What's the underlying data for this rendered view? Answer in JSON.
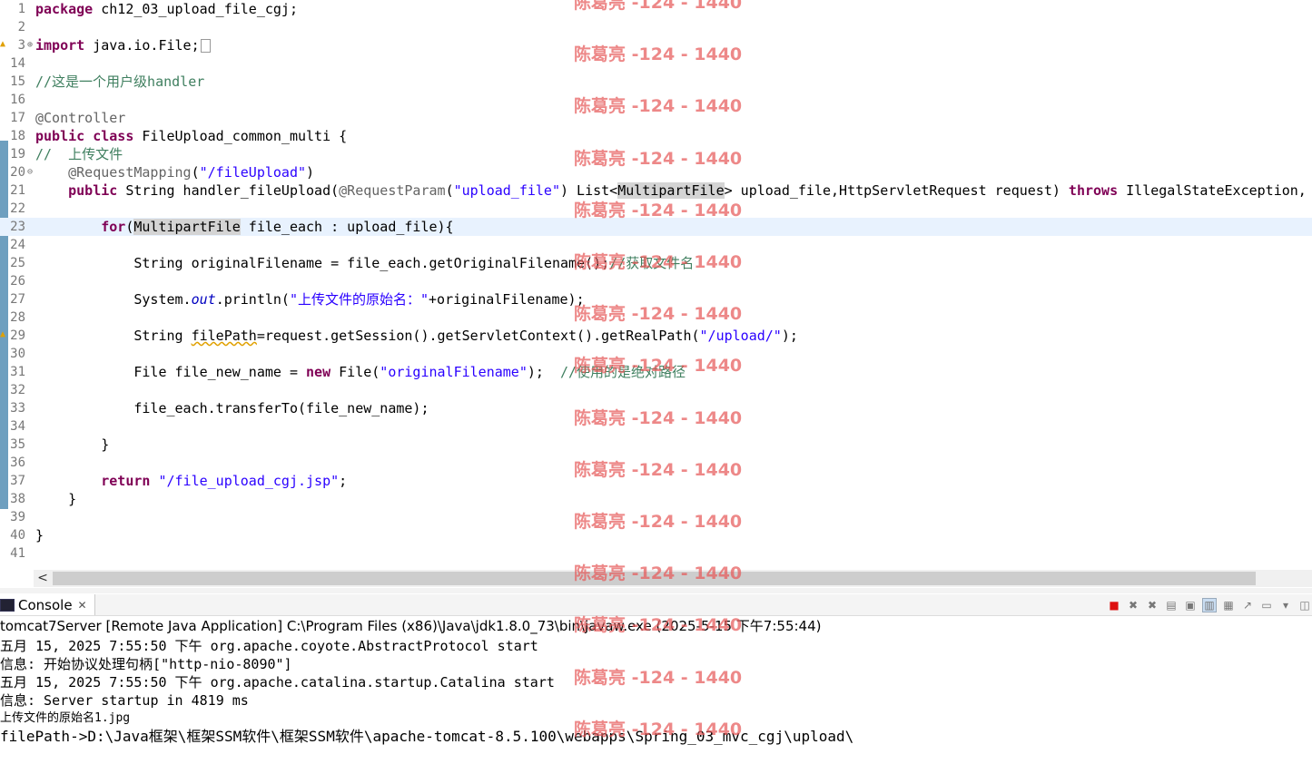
{
  "editor": {
    "lines": [
      {
        "n": "1",
        "segs": [
          {
            "t": "package",
            "c": "kw"
          },
          {
            "t": " ch12_03_upload_file_cgj;"
          }
        ]
      },
      {
        "n": "2",
        "segs": []
      },
      {
        "n": "3",
        "fold": "⊕",
        "warn": true,
        "box": true,
        "segs": [
          {
            "t": "import",
            "c": "kw"
          },
          {
            "t": " java.io.File;"
          }
        ]
      },
      {
        "n": "14",
        "segs": []
      },
      {
        "n": "15",
        "segs": [
          {
            "t": "//这是一个用户级handler",
            "c": "cmt"
          }
        ]
      },
      {
        "n": "16",
        "segs": []
      },
      {
        "n": "17",
        "segs": [
          {
            "t": "@Controller",
            "c": "ann"
          }
        ]
      },
      {
        "n": "18",
        "segs": [
          {
            "t": "public",
            "c": "kw"
          },
          {
            "t": " "
          },
          {
            "t": "class",
            "c": "kw"
          },
          {
            "t": " FileUpload_common_multi {"
          }
        ]
      },
      {
        "n": "19",
        "segs": [
          {
            "t": "//  上传文件",
            "c": "cmt"
          }
        ]
      },
      {
        "n": "20",
        "fold": "⊖",
        "segs": [
          {
            "t": "    "
          },
          {
            "t": "@RequestMapping",
            "c": "ann"
          },
          {
            "t": "("
          },
          {
            "t": "\"/fileUpload\"",
            "c": "str"
          },
          {
            "t": ")"
          }
        ]
      },
      {
        "n": "21",
        "segs": [
          {
            "t": "    "
          },
          {
            "t": "public",
            "c": "kw"
          },
          {
            "t": " String handler_fileUpload("
          },
          {
            "t": "@RequestParam",
            "c": "ann"
          },
          {
            "t": "("
          },
          {
            "t": "\"upload_file\"",
            "c": "str"
          },
          {
            "t": ") List<"
          },
          {
            "t": "MultipartFile",
            "c": "hl"
          },
          {
            "t": "> upload_file,HttpServletRequest request) "
          },
          {
            "t": "throws",
            "c": "kw"
          },
          {
            "t": " IllegalStateException, I"
          }
        ]
      },
      {
        "n": "22",
        "segs": []
      },
      {
        "n": "23",
        "current": true,
        "segs": [
          {
            "t": "        "
          },
          {
            "t": "for",
            "c": "kw"
          },
          {
            "t": "("
          },
          {
            "t": "MultipartFile",
            "c": "hl"
          },
          {
            "t": " file_each : upload_file){"
          }
        ]
      },
      {
        "n": "24",
        "segs": []
      },
      {
        "n": "25",
        "segs": [
          {
            "t": "            String originalFilename = file_each.getOriginalFilename();"
          },
          {
            "t": "//获取文件名",
            "c": "cmt"
          }
        ]
      },
      {
        "n": "26",
        "segs": []
      },
      {
        "n": "27",
        "segs": [
          {
            "t": "            System."
          },
          {
            "t": "out",
            "c": "ital"
          },
          {
            "t": ".println("
          },
          {
            "t": "\"上传文件的原始名：\"",
            "c": "str"
          },
          {
            "t": "+originalFilename);"
          }
        ]
      },
      {
        "n": "28",
        "segs": []
      },
      {
        "n": "29",
        "warn": true,
        "segs": [
          {
            "t": "            String "
          },
          {
            "t": "filePath",
            "c": "squig"
          },
          {
            "t": "=request.getSession().getServletContext().getRealPath("
          },
          {
            "t": "\"/upload/\"",
            "c": "str"
          },
          {
            "t": ");"
          }
        ]
      },
      {
        "n": "30",
        "segs": []
      },
      {
        "n": "31",
        "segs": [
          {
            "t": "            File file_new_name = "
          },
          {
            "t": "new",
            "c": "kw"
          },
          {
            "t": " File("
          },
          {
            "t": "\"originalFilename\"",
            "c": "str"
          },
          {
            "t": ");  "
          },
          {
            "t": "//使用的是绝对路径",
            "c": "cmt"
          }
        ]
      },
      {
        "n": "32",
        "segs": []
      },
      {
        "n": "33",
        "segs": [
          {
            "t": "            file_each.transferTo(file_new_name);"
          }
        ]
      },
      {
        "n": "34",
        "segs": []
      },
      {
        "n": "35",
        "segs": [
          {
            "t": "        }"
          }
        ]
      },
      {
        "n": "36",
        "segs": []
      },
      {
        "n": "37",
        "segs": [
          {
            "t": "        "
          },
          {
            "t": "return",
            "c": "kw"
          },
          {
            "t": " "
          },
          {
            "t": "\"/file_upload_cgj.jsp\"",
            "c": "str"
          },
          {
            "t": ";"
          }
        ]
      },
      {
        "n": "38",
        "segs": [
          {
            "t": "    }"
          }
        ]
      },
      {
        "n": "39",
        "segs": []
      },
      {
        "n": "40",
        "segs": [
          {
            "t": "}"
          }
        ]
      },
      {
        "n": "41",
        "segs": []
      }
    ]
  },
  "scrollbar": {
    "left_arrow": "<"
  },
  "console": {
    "tab_label": "Console",
    "tab_close": "✕",
    "toolbar": [
      {
        "name": "terminate-icon",
        "glyph": "■",
        "cls": "stop"
      },
      {
        "name": "remove-launch-icon",
        "glyph": "✖",
        "cls": ""
      },
      {
        "name": "remove-all-icon",
        "glyph": "✖",
        "cls": ""
      },
      {
        "name": "clear-console-icon",
        "glyph": "▤",
        "cls": ""
      },
      {
        "name": "scroll-lock-icon",
        "glyph": "▣",
        "cls": ""
      },
      {
        "name": "word-wrap-icon",
        "glyph": "▥",
        "cls": "active"
      },
      {
        "name": "show-on-output-icon",
        "glyph": "▦",
        "cls": ""
      },
      {
        "name": "pin-console-icon",
        "glyph": "↗",
        "cls": ""
      },
      {
        "name": "display-console-icon",
        "glyph": "▭",
        "cls": ""
      },
      {
        "name": "dropdown-icon",
        "glyph": "▾",
        "cls": ""
      },
      {
        "name": "new-console-icon",
        "glyph": "◫",
        "cls": ""
      }
    ],
    "process": "tomcat7Server [Remote Java Application] C:\\Program Files (x86)\\Java\\jdk1.8.0_73\\bin\\javaw.exe (2025-5-15 下午7:55:44)",
    "lines": [
      {
        "text": "五月 15, 2025 7:55:50 下午 org.apache.coyote.AbstractProtocol start",
        "color": "#000000",
        "size": ""
      },
      {
        "text": "信息: 开始协议处理句柄[\"http-nio-8090\"]",
        "color": "#000000",
        "size": ""
      },
      {
        "text": "五月 15, 2025 7:55:50 下午 org.apache.catalina.startup.Catalina start",
        "color": "#000000",
        "size": ""
      },
      {
        "text": "信息: Server startup in 4819 ms",
        "color": "#000000",
        "size": ""
      },
      {
        "text": "上传文件的原始名1.jpg",
        "color": "#000000",
        "size": "small"
      },
      {
        "text": "filePath->D:\\Java框架\\框架SSM软件\\框架SSM软件\\apache-tomcat-8.5.100\\webapps\\Spring_03_mvc_cgj\\upload\\",
        "color": "#000000",
        "size": "big"
      }
    ]
  },
  "watermark": {
    "text": "陈葛亮 -124 - 1440",
    "count": 15
  }
}
